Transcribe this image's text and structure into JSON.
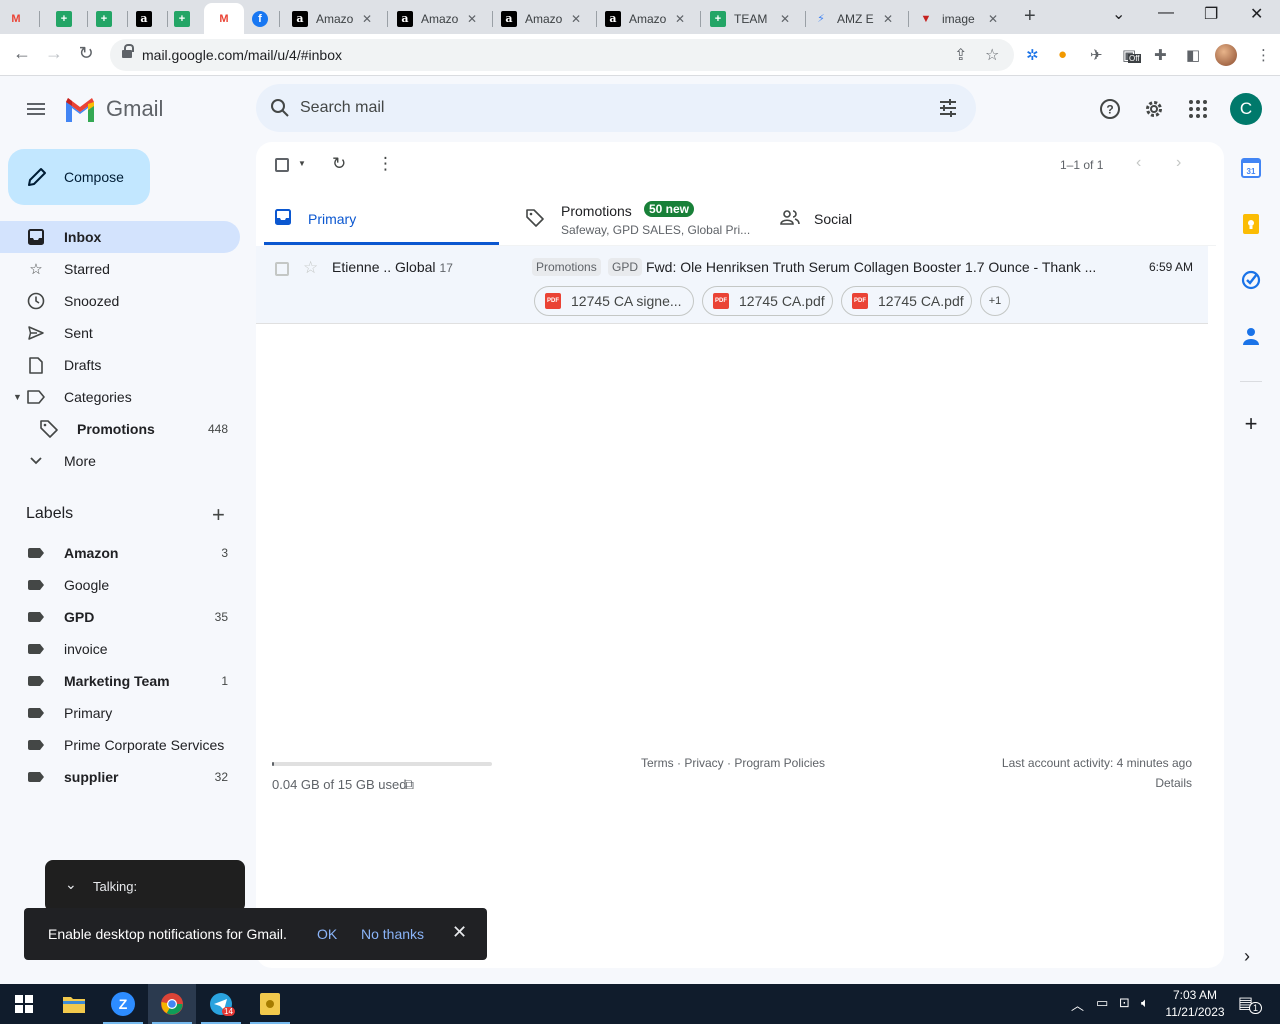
{
  "browser": {
    "tabs": [
      {
        "icon": "gmail-icon",
        "title": ""
      },
      {
        "icon": "sheets-icon",
        "title": ""
      },
      {
        "icon": "sheets-icon",
        "title": ""
      },
      {
        "icon": "amazon-icon",
        "title": ""
      },
      {
        "icon": "sheets-icon",
        "title": ""
      },
      {
        "icon": "gmail-icon",
        "title": "",
        "active": true
      },
      {
        "icon": "facebook-icon",
        "title": ""
      },
      {
        "icon": "amazon-icon",
        "title": "Amazo"
      },
      {
        "icon": "amazon-icon",
        "title": "Amazo"
      },
      {
        "icon": "amazon-icon",
        "title": "Amazo"
      },
      {
        "icon": "amazon-icon",
        "title": "Amazo"
      },
      {
        "icon": "sheets-icon",
        "title": "TEAM"
      },
      {
        "icon": "amz-icon",
        "title": "AMZ E"
      },
      {
        "icon": "image-icon",
        "title": "image"
      }
    ],
    "url": "mail.google.com/mail/u/4/#inbox",
    "extension_badge": "Off"
  },
  "gmail": {
    "brand": "Gmail",
    "search_placeholder": "Search mail",
    "avatar_letter": "C",
    "compose_label": "Compose",
    "nav": [
      {
        "label": "Inbox",
        "count": "",
        "icon": "inbox-icon"
      },
      {
        "label": "Starred",
        "count": "",
        "icon": "star-icon"
      },
      {
        "label": "Snoozed",
        "count": "",
        "icon": "clock-icon"
      },
      {
        "label": "Sent",
        "count": "",
        "icon": "send-icon"
      },
      {
        "label": "Drafts",
        "count": "",
        "icon": "draft-icon"
      },
      {
        "label": "Categories",
        "count": "",
        "icon": "label-icon"
      },
      {
        "label": "Promotions",
        "count": "448",
        "icon": "tag-icon"
      },
      {
        "label": "More",
        "count": "",
        "icon": "chevron-down-icon"
      }
    ],
    "labels_title": "Labels",
    "labels": [
      {
        "label": "Amazon",
        "count": "3"
      },
      {
        "label": "Google",
        "count": ""
      },
      {
        "label": "GPD",
        "count": "35"
      },
      {
        "label": "invoice",
        "count": ""
      },
      {
        "label": "Marketing Team",
        "count": "1"
      },
      {
        "label": "Primary",
        "count": ""
      },
      {
        "label": "Prime Corporate Services",
        "count": ""
      },
      {
        "label": "supplier",
        "count": "32"
      }
    ],
    "pager": "1–1 of 1",
    "tabs": {
      "primary": "Primary",
      "promotions": "Promotions",
      "promotions_badge": "50 new",
      "promotions_sub": "Safeway, GPD SALES, Global Pri...",
      "social": "Social"
    },
    "mail": {
      "sender": "Etienne .. Global",
      "count": "17",
      "tag1": "Promotions",
      "tag2": "GPD",
      "subject": "Fwd: Ole Henriksen Truth Serum Collagen Booster 1.7 Ounce - Thank ...",
      "time": "6:59 AM",
      "attachments": [
        "12745 CA signe...",
        "12745 CA.pdf",
        "12745 CA.pdf"
      ],
      "more": "+1",
      "pdf_badge": "PDF"
    },
    "footer": {
      "storage_fraction": 0.003,
      "storage": "0.04 GB of 15 GB used",
      "links": "Terms · Privacy · Program Policies",
      "activity": "Last account activity: 4 minutes ago",
      "details": "Details"
    },
    "talking": "Talking:",
    "notification": {
      "message": "Enable desktop notifications for Gmail.",
      "ok": "OK",
      "no_thanks": "No thanks"
    }
  },
  "taskbar": {
    "time": "7:03 AM",
    "date": "11/21/2023",
    "telegram_badge": "14",
    "notification_count": "1"
  }
}
